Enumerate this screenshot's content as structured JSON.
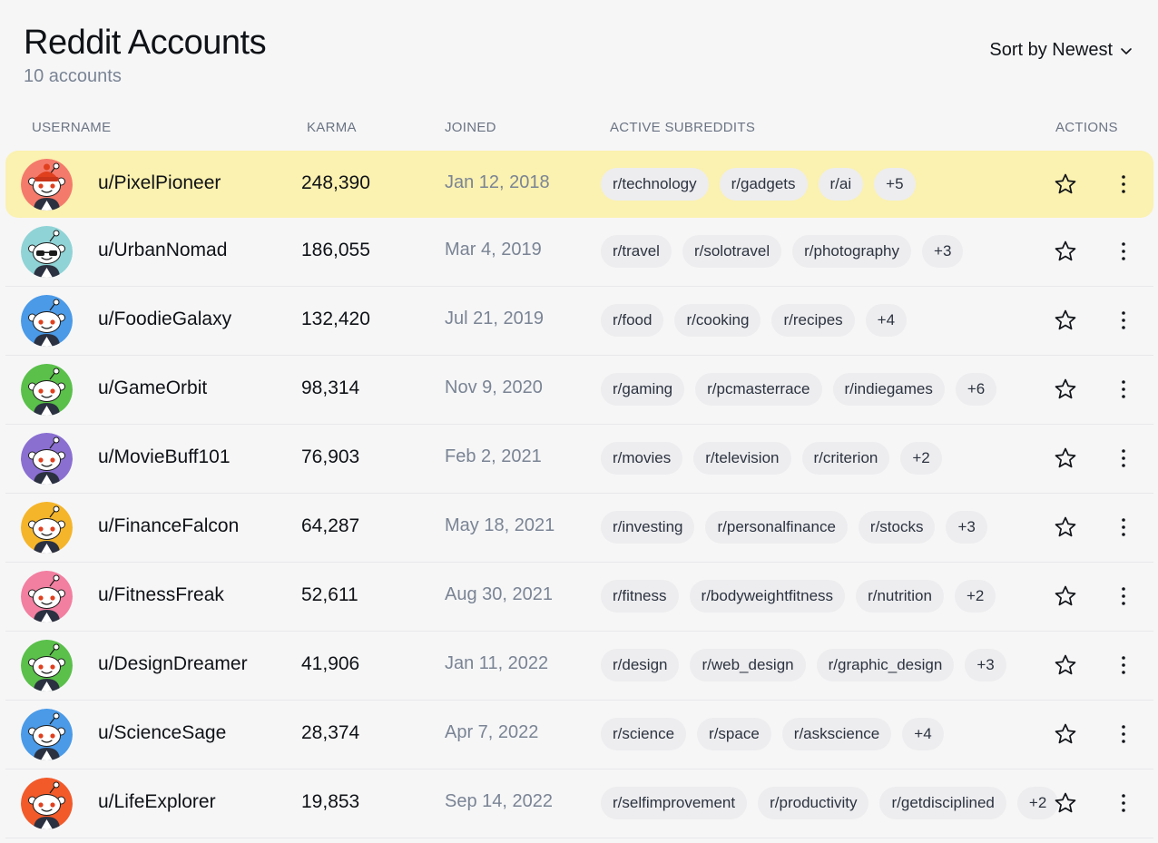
{
  "header": {
    "title": "Reddit Accounts",
    "subtitle": "10 accounts",
    "sort_label": "Sort by Newest"
  },
  "columns": {
    "username": "USERNAME",
    "karma": "KARMA",
    "joined": "JOINED",
    "subreddits": "ACTIVE SUBREDDITS",
    "actions": "ACTIONS"
  },
  "accounts": [
    {
      "username": "u/PixelPioneer",
      "karma": "248,390",
      "joined": "Jan 12, 2018",
      "subreddits": [
        "r/technology",
        "r/gadgets",
        "r/ai"
      ],
      "more": "+5",
      "avatar_color": "#f47a6b",
      "highlighted": true,
      "accessory": "beanie"
    },
    {
      "username": "u/UrbanNomad",
      "karma": "186,055",
      "joined": "Mar 4, 2019",
      "subreddits": [
        "r/travel",
        "r/solotravel",
        "r/photography"
      ],
      "more": "+3",
      "avatar_color": "#8fd3d6",
      "highlighted": false,
      "accessory": "sunglasses"
    },
    {
      "username": "u/FoodieGalaxy",
      "karma": "132,420",
      "joined": "Jul 21, 2019",
      "subreddits": [
        "r/food",
        "r/cooking",
        "r/recipes"
      ],
      "more": "+4",
      "avatar_color": "#4a9ae8",
      "highlighted": false,
      "accessory": "none"
    },
    {
      "username": "u/GameOrbit",
      "karma": "98,314",
      "joined": "Nov 9, 2020",
      "subreddits": [
        "r/gaming",
        "r/pcmasterrace",
        "r/indiegames"
      ],
      "more": "+6",
      "avatar_color": "#5ac04a",
      "highlighted": false,
      "accessory": "none"
    },
    {
      "username": "u/MovieBuff101",
      "karma": "76,903",
      "joined": "Feb 2, 2021",
      "subreddits": [
        "r/movies",
        "r/television",
        "r/criterion"
      ],
      "more": "+2",
      "avatar_color": "#8a6fd1",
      "highlighted": false,
      "accessory": "none"
    },
    {
      "username": "u/FinanceFalcon",
      "karma": "64,287",
      "joined": "May 18, 2021",
      "subreddits": [
        "r/investing",
        "r/personalfinance",
        "r/stocks"
      ],
      "more": "+3",
      "avatar_color": "#f5b52a",
      "highlighted": false,
      "accessory": "none"
    },
    {
      "username": "u/FitnessFreak",
      "karma": "52,611",
      "joined": "Aug 30, 2021",
      "subreddits": [
        "r/fitness",
        "r/bodyweightfitness",
        "r/nutrition"
      ],
      "more": "+2",
      "avatar_color": "#f27fa0",
      "highlighted": false,
      "accessory": "none"
    },
    {
      "username": "u/DesignDreamer",
      "karma": "41,906",
      "joined": "Jan 11, 2022",
      "subreddits": [
        "r/design",
        "r/web_design",
        "r/graphic_design"
      ],
      "more": "+3",
      "avatar_color": "#5ac04a",
      "highlighted": false,
      "accessory": "none"
    },
    {
      "username": "u/ScienceSage",
      "karma": "28,374",
      "joined": "Apr 7, 2022",
      "subreddits": [
        "r/science",
        "r/space",
        "r/askscience"
      ],
      "more": "+4",
      "avatar_color": "#4a9ae8",
      "highlighted": false,
      "accessory": "none"
    },
    {
      "username": "u/LifeExplorer",
      "karma": "19,853",
      "joined": "Sep 14, 2022",
      "subreddits": [
        "r/selfimprovement",
        "r/productivity",
        "r/getdisciplined"
      ],
      "more": "+2",
      "avatar_color": "#f25a2a",
      "highlighted": false,
      "accessory": "none"
    }
  ],
  "icons": {
    "sort": "chevron-down-icon",
    "favorite": "star-icon",
    "menu": "more-vertical-icon",
    "avatar": "snoo-avatar-icon"
  }
}
